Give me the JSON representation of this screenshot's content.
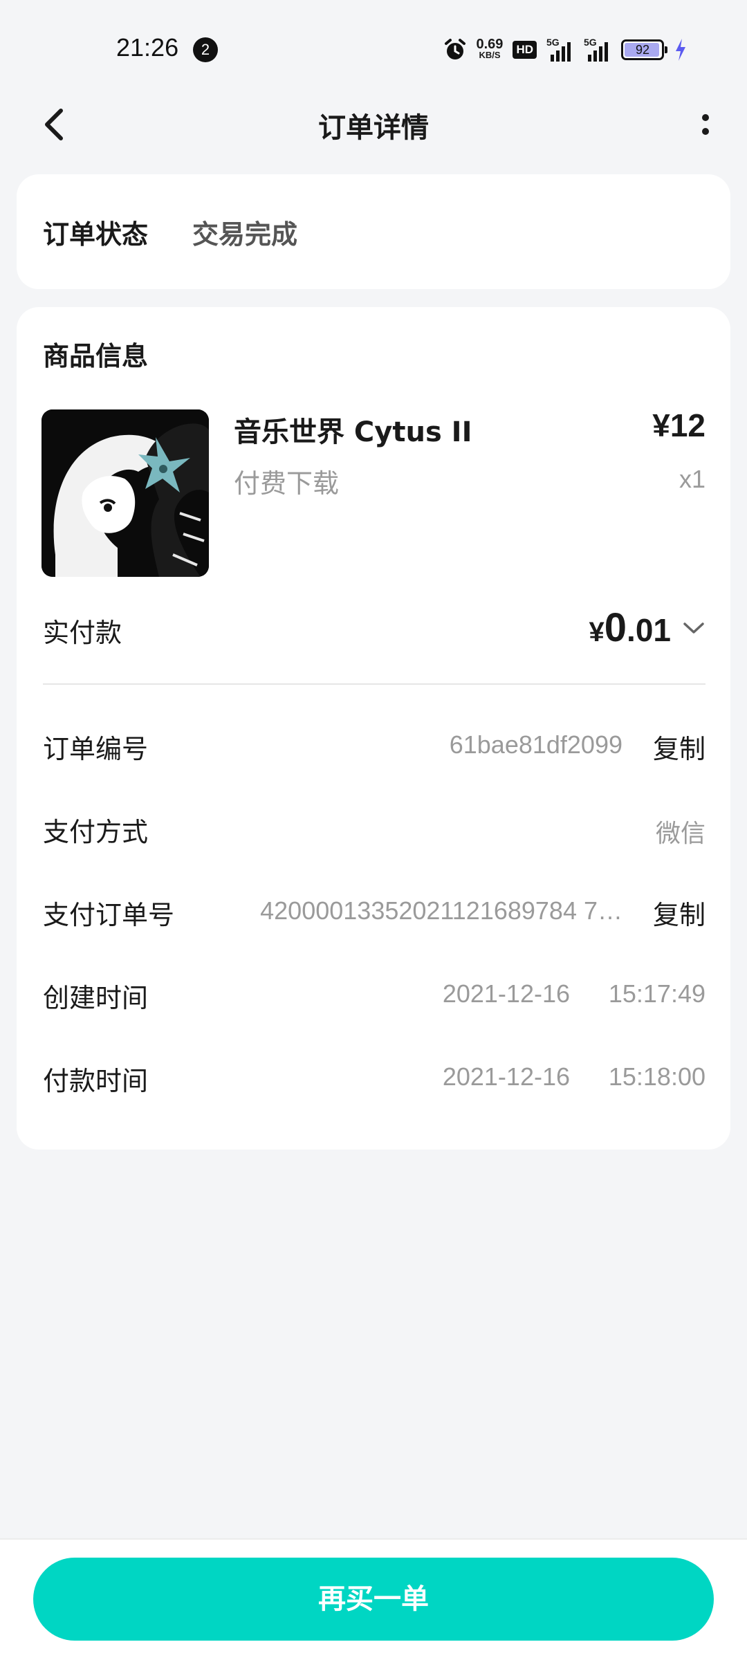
{
  "status_bar": {
    "time": "21:26",
    "notification_count": "2",
    "net_speed": "0.69",
    "net_unit": "KB/S",
    "hd_label": "HD",
    "signal1_label": "5G",
    "signal2_label": "5G",
    "battery_percent": "92"
  },
  "header": {
    "title": "订单详情"
  },
  "order_status": {
    "label": "订单状态",
    "value": "交易完成"
  },
  "product_section": {
    "title": "商品信息",
    "name": "音乐世界 Cytus II",
    "price": "¥12",
    "type": "付费下载",
    "quantity": "x1"
  },
  "payment": {
    "label": "实付款",
    "currency": "¥",
    "amount_int": "0",
    "amount_dec": ".01"
  },
  "details": {
    "order_no_label": "订单编号",
    "order_no_value": "61bae81df2099",
    "copy_label": "复制",
    "pay_method_label": "支付方式",
    "pay_method_value": "微信",
    "pay_order_label": "支付订单号",
    "pay_order_value": "42000013352021121689784 7…",
    "created_label": "创建时间",
    "created_date": "2021-12-16",
    "created_time": "15:17:49",
    "paid_time_label": "付款时间",
    "paid_date": "2021-12-16",
    "paid_time": "15:18:00"
  },
  "bottom": {
    "rebuy_label": "再买一单"
  },
  "colors": {
    "accent": "#00d6c3",
    "background": "#f4f5f7",
    "muted_text": "#9a9a9a"
  }
}
